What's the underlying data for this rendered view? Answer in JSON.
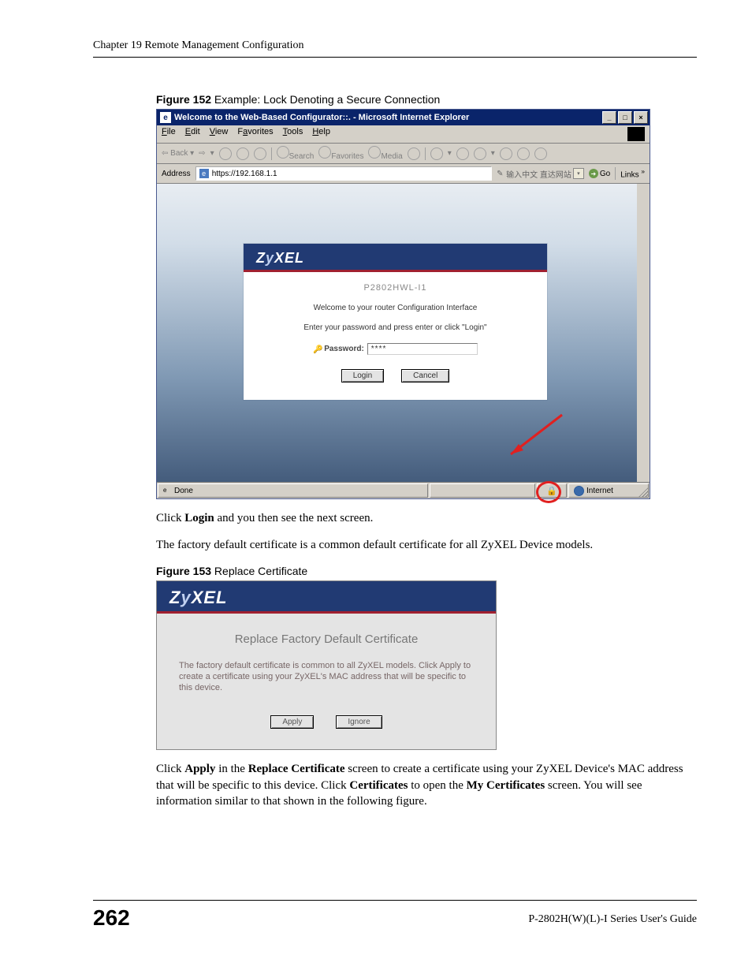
{
  "header": {
    "chapter": "Chapter 19 Remote Management Configuration"
  },
  "fig152": {
    "caption_bold": "Figure 152",
    "caption_rest": "   Example: Lock Denoting a Secure Connection",
    "ie": {
      "title": "Welcome to the Web-Based Configurator::. - Microsoft Internet Explorer",
      "menu": {
        "file": "File",
        "edit": "Edit",
        "view": "View",
        "favorites": "Favorites",
        "tools": "Tools",
        "help": "Help"
      },
      "toolbar": {
        "back": "Back",
        "search": "Search",
        "favorites": "Favorites",
        "media": "Media"
      },
      "address": {
        "label": "Address",
        "url": "https://192.168.1.1",
        "ime": "输入中文 直达网站",
        "go": "Go",
        "links": "Links"
      },
      "login": {
        "brand": "ZyXEL",
        "model": "P2802HWL-I1",
        "welcome": "Welcome to your router Configuration Interface",
        "instruct": "Enter your password and press enter or click \"Login\"",
        "pw_label": "Password:",
        "pw_value": "****",
        "login_btn": "Login",
        "cancel_btn": "Cancel"
      },
      "status": {
        "done": "Done",
        "zone": "Internet"
      }
    }
  },
  "para1_pre": "Click ",
  "para1_bold": "Login",
  "para1_post": " and you then see the next screen.",
  "para2": "The factory default certificate is a common default certificate for all ZyXEL Device models.",
  "fig153": {
    "caption_bold": "Figure 153",
    "caption_rest": "   Replace Certificate",
    "brand": "ZyXEL",
    "title": "Replace Factory Default Certificate",
    "text": "The factory default certificate is common to all ZyXEL models. Click Apply to create a certificate using your ZyXEL's MAC address that will be specific to this device.",
    "apply": "Apply",
    "ignore": "Ignore"
  },
  "para3": {
    "t1": "Click ",
    "b1": "Apply",
    "t2": " in the ",
    "b2": "Replace Certificate",
    "t3": " screen to create a certificate using your ZyXEL Device's MAC address that will be specific to this device. Click ",
    "b3": "Certificates",
    "t4": " to open the ",
    "b4": "My Certificates",
    "t5": " screen. You will see information similar to that shown in the following figure."
  },
  "footer": {
    "page": "262",
    "guide": "P-2802H(W)(L)-I Series User's Guide"
  }
}
